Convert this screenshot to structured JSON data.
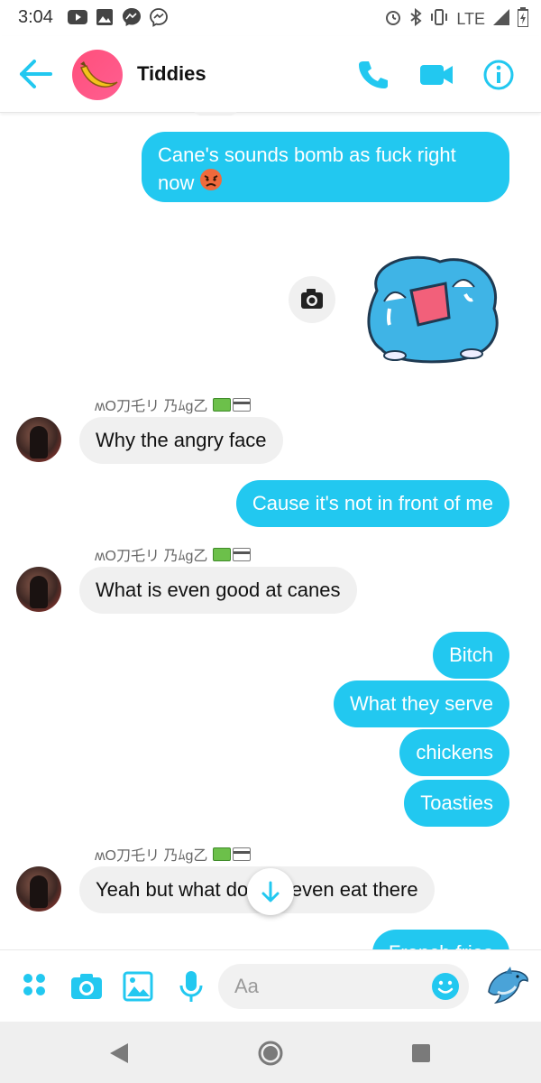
{
  "status_bar": {
    "time": "3:04",
    "network": "LTE"
  },
  "header": {
    "title": "Tiddies",
    "accent": "#22c8f0"
  },
  "messages": [
    {
      "dir": "out",
      "text": "Cane's sounds bomb as fuck right"
    },
    {
      "dir": "out",
      "text": "now"
    },
    {
      "dir": "in",
      "sender": "ʍO刀乇リ 乃ﾑg乙",
      "text": "Why the angry face"
    },
    {
      "dir": "out",
      "text": "Cause it's not in front of me"
    },
    {
      "dir": "in",
      "sender": "ʍO刀乇リ 乃ﾑg乙",
      "text": "What is even good at canes"
    },
    {
      "dir": "out",
      "text": "Bitch"
    },
    {
      "dir": "out",
      "text": "What they serve"
    },
    {
      "dir": "out",
      "text": "chickens"
    },
    {
      "dir": "out",
      "text": "Toasties"
    },
    {
      "dir": "in",
      "sender": "ʍO刀乇リ 乃ﾑg乙",
      "text": "Yeah but what do you even eat there"
    },
    {
      "dir": "out",
      "text": "French fries"
    }
  ],
  "composer": {
    "placeholder": "Aa",
    "value": ""
  },
  "icons": {
    "back": "arrow-left-icon",
    "call": "phone-icon",
    "video": "video-camera-icon",
    "info": "info-icon",
    "apps": "more-apps-icon",
    "camera": "camera-icon",
    "gallery": "image-icon",
    "mic": "microphone-icon",
    "emoji": "emoji-icon",
    "sticker_send": "dolphin-icon"
  }
}
